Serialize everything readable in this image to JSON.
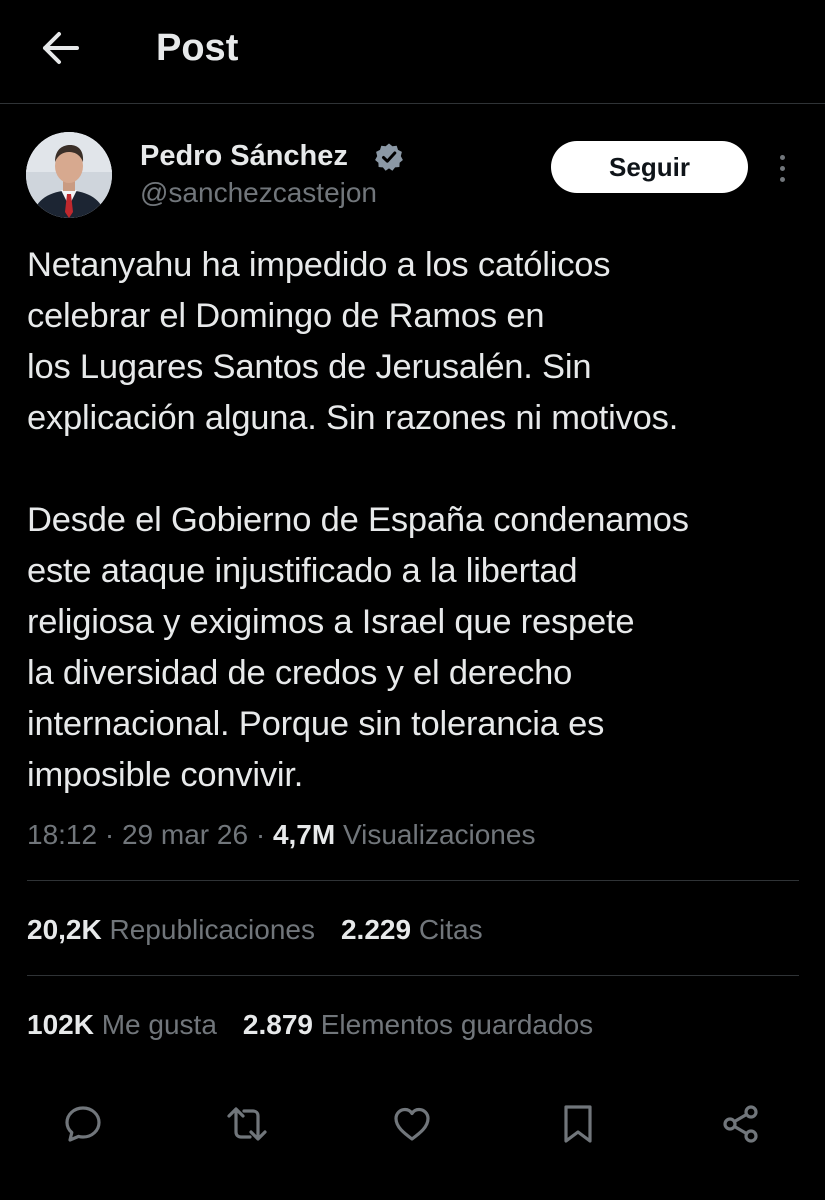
{
  "header": {
    "title": "Post",
    "back_icon": "arrow-left-icon"
  },
  "author": {
    "display_name": "Pedro Sánchez",
    "handle": "@sanchezcastejon",
    "verified": true,
    "verified_color": "#8b98a5",
    "follow_label": "Seguir"
  },
  "post": {
    "text": "Netanyahu ha impedido a los católicos\ncelebrar el Domingo de Ramos en\nlos Lugares Santos de Jerusalén. Sin\nexplicación alguna. Sin razones ni motivos.\n\nDesde el Gobierno de España condenamos\neste ataque injustificado a la libertad\nreligiosa y exigimos a Israel que respete\nla diversidad de credos y el derecho\ninternacional. Porque sin tolerancia es\nimposible convivir.",
    "time": "18:12",
    "date": "29 mar 26",
    "views_count": "4,7M",
    "views_label": "Visualizaciones",
    "separator": "·"
  },
  "stats": {
    "reposts_count": "20,2K",
    "reposts_label": "Republicaciones",
    "quotes_count": "2.229",
    "quotes_label": "Citas",
    "likes_count": "102K",
    "likes_label": "Me gusta",
    "bookmarks_count": "2.879",
    "bookmarks_label": "Elementos guardados"
  },
  "actions": [
    "reply-icon",
    "repost-icon",
    "like-icon",
    "bookmark-icon",
    "share-icon"
  ],
  "colors": {
    "background": "#000000",
    "text_primary": "#e7e9ea",
    "text_secondary": "#71767b",
    "divider": "#2f3336",
    "follow_button_bg": "#ffffff"
  }
}
